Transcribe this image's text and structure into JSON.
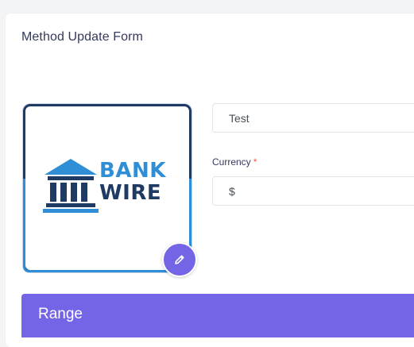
{
  "form": {
    "title": "Method Update Form"
  },
  "logo": {
    "word_top": "BANK",
    "word_bottom": "WIRE",
    "color_light": "#2f8ed6",
    "color_dark": "#1f3a63"
  },
  "edit_button": {
    "icon": "pencil-icon",
    "color": "#7464e6"
  },
  "name_field": {
    "value": "Test"
  },
  "currency_field": {
    "label": "Currency",
    "required_mark": "*",
    "value": "$"
  },
  "range_section": {
    "title": "Range",
    "color": "#7464e6"
  }
}
